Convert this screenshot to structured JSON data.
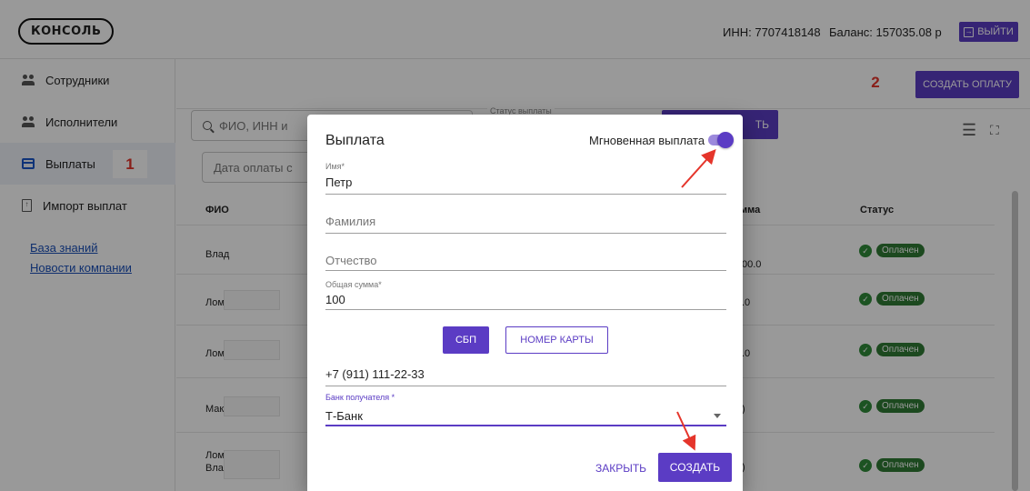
{
  "header": {
    "logo": "КОНСОЛЬ",
    "inn": "ИНН: 7707418148",
    "balance": "Баланс: 157035.08 р",
    "logout_label": "ВЫЙТИ"
  },
  "sidebar": {
    "items": [
      {
        "label": "Сотрудники",
        "icon": "people-icon"
      },
      {
        "label": "Исполнители",
        "icon": "people-icon"
      },
      {
        "label": "Выплаты",
        "icon": "card-icon"
      },
      {
        "label": "Импорт выплат",
        "icon": "import-icon"
      }
    ],
    "links": [
      "База знаний",
      "Новости компании"
    ],
    "annotation_1": "1"
  },
  "content": {
    "create_payment_label": "СОЗДАТЬ ОПЛАТУ",
    "annotation_2": "2",
    "search_placeholder": "ФИО, ИНН и",
    "status_legend": "Статус выплаты",
    "date_placeholder": "Дата оплаты с",
    "apply_label_partial": "ТЬ",
    "columns": [
      "ФИО",
      "мма",
      "Статус"
    ],
    "rows": [
      {
        "name": "Влад",
        "sum": "00.0",
        "status": "Оплачен"
      },
      {
        "name": "Лом",
        "sum": ".0",
        "status": "Оплачен"
      },
      {
        "name": "Лом",
        "sum": ".0",
        "status": "Оплачен"
      },
      {
        "name": "Мак",
        "sum": ")",
        "status": "Оплачен"
      },
      {
        "name": "Лом",
        "name2": "Вла",
        "sum": ")",
        "status": "Оплачен"
      }
    ]
  },
  "dialog": {
    "title": "Выплата",
    "instant_label": "Мгновенная выплата",
    "instant_enabled": true,
    "first_name_label": "Имя",
    "first_name_value": "Петр",
    "last_name_placeholder": "Фамилия",
    "middle_name_placeholder": "Отчество",
    "total_label": "Общая сумма",
    "total_value": "100",
    "sbp_label": "СБП",
    "card_label": "НОМЕР КАРТЫ",
    "phone_value": "+7 (911) 111-22-33",
    "bank_label": "Банк получателя",
    "bank_value": "Т-Банк",
    "close_label": "ЗАКРЫТЬ",
    "submit_label": "СОЗДАТЬ"
  },
  "colors": {
    "accent": "#5b3cc4",
    "paid": "#2f7a34",
    "annotation": "#e5352b"
  }
}
